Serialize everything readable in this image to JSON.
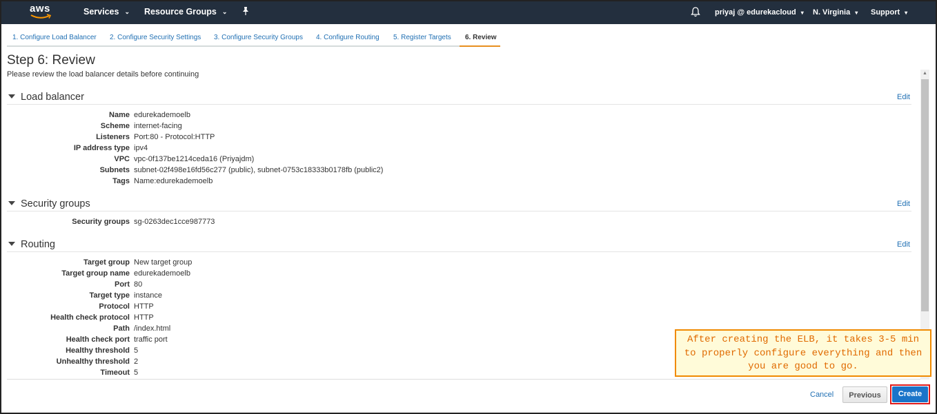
{
  "nav": {
    "logo_text": "aws",
    "services": "Services",
    "resource_groups": "Resource Groups",
    "user": "priyaj @ edurekacloud",
    "region": "N. Virginia",
    "support": "Support"
  },
  "tabs": [
    {
      "label": "1. Configure Load Balancer",
      "active": false
    },
    {
      "label": "2. Configure Security Settings",
      "active": false
    },
    {
      "label": "3. Configure Security Groups",
      "active": false
    },
    {
      "label": "4. Configure Routing",
      "active": false
    },
    {
      "label": "5. Register Targets",
      "active": false
    },
    {
      "label": "6. Review",
      "active": true
    }
  ],
  "page": {
    "title": "Step 6: Review",
    "subtitle": "Please review the load balancer details before continuing"
  },
  "sections": {
    "load_balancer": {
      "title": "Load balancer",
      "edit": "Edit",
      "fields": [
        {
          "key": "Name",
          "value": "edurekademoelb"
        },
        {
          "key": "Scheme",
          "value": "internet-facing"
        },
        {
          "key": "Listeners",
          "value": "Port:80 - Protocol:HTTP"
        },
        {
          "key": "IP address type",
          "value": "ipv4"
        },
        {
          "key": "VPC",
          "value": "vpc-0f137be1214ceda16 (Priyajdm)"
        },
        {
          "key": "Subnets",
          "value": "subnet-02f498e16fd56c277 (public), subnet-0753c18333b0178fb (public2)"
        },
        {
          "key": "Tags",
          "value": "Name:edurekademoelb"
        }
      ]
    },
    "security_groups": {
      "title": "Security groups",
      "edit": "Edit",
      "fields": [
        {
          "key": "Security groups",
          "value": "sg-0263dec1cce987773"
        }
      ]
    },
    "routing": {
      "title": "Routing",
      "edit": "Edit",
      "fields": [
        {
          "key": "Target group",
          "value": "New target group"
        },
        {
          "key": "Target group name",
          "value": "edurekademoelb"
        },
        {
          "key": "Port",
          "value": "80"
        },
        {
          "key": "Target type",
          "value": "instance"
        },
        {
          "key": "Protocol",
          "value": "HTTP"
        },
        {
          "key": "Health check protocol",
          "value": "HTTP"
        },
        {
          "key": "Path",
          "value": "/index.html"
        },
        {
          "key": "Health check port",
          "value": "traffic port"
        },
        {
          "key": "Healthy threshold",
          "value": "5"
        },
        {
          "key": "Unhealthy threshold",
          "value": "2"
        },
        {
          "key": "Timeout",
          "value": "5"
        }
      ]
    }
  },
  "footer": {
    "cancel": "Cancel",
    "previous": "Previous",
    "create": "Create"
  },
  "annotation": {
    "lines": [
      "After creating the ELB, it takes 3-5 min",
      "to properly configure everything and then",
      "you are good to go."
    ]
  },
  "colors": {
    "nav_bg": "#232f3e",
    "link": "#1f6fb3",
    "active_tab": "#e78f1e",
    "create_button": "#1a74c9",
    "highlight_outline": "#e01a1a",
    "annotation_border": "#f08a00",
    "annotation_bg": "#fffbd9",
    "annotation_text": "#e06a00"
  }
}
